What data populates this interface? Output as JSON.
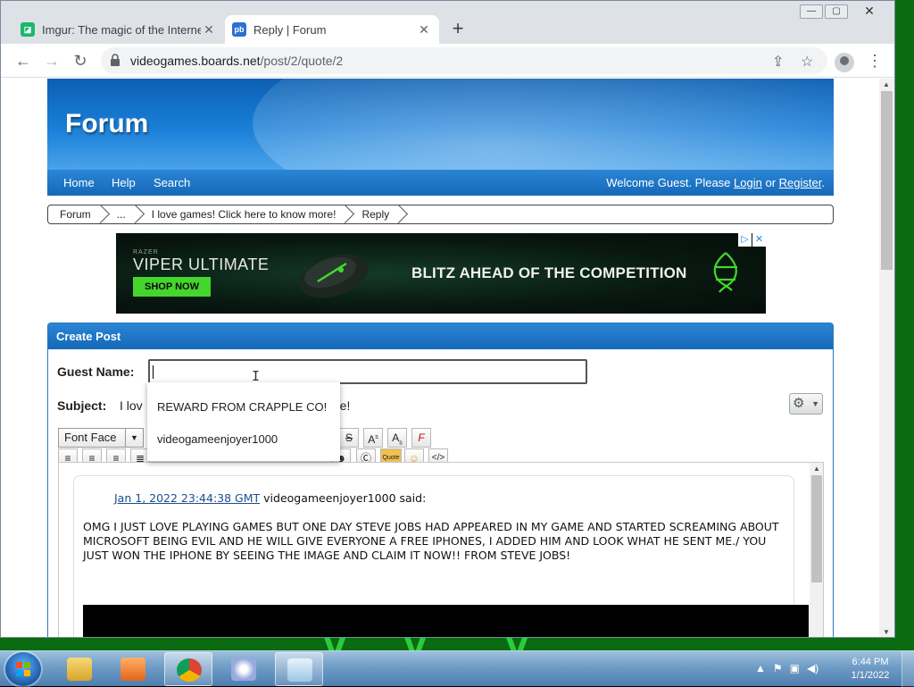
{
  "browser": {
    "tabs": [
      {
        "title": "Imgur: The magic of the Internet",
        "favicon": "imgur-icon"
      },
      {
        "title": "Reply | Forum",
        "favicon": "proboards-icon"
      }
    ],
    "url_domain": "videogames.boards.net",
    "url_path": "/post/2/quote/2"
  },
  "forum": {
    "title": "Forum",
    "nav": [
      "Home",
      "Help",
      "Search"
    ],
    "welcome_prefix": "Welcome Guest. Please",
    "login": "Login",
    "or": "or",
    "register": "Register",
    "breadcrumbs": [
      "Forum",
      "...",
      "I love games! Click here to know more!",
      "Reply"
    ]
  },
  "ad": {
    "brand": "RAZER",
    "product": "VIPER ULTIMATE",
    "cta": "SHOP NOW",
    "headline": "BLITZ AHEAD OF THE COMPETITION",
    "accent": "#44d62c"
  },
  "post": {
    "header": "Create Post",
    "guest_name_label": "Guest Name:",
    "guest_name_value": "",
    "subject_label": "Subject:",
    "subject_visible_start": "I lov",
    "subject_visible_end": "re!",
    "font_face": "Font Face",
    "autocomplete": [
      "REWARD FROM CRAPPLE CO!",
      "videogameenjoyer1000"
    ],
    "quote": {
      "date": "Jan 1, 2022 23:44:38 GMT",
      "author_said": "videogameenjoyer1000 said:",
      "body": "OMG I JUST LOVE PLAYING GAMES BUT ONE DAY STEVE JOBS HAD APPEARED IN MY GAME AND STARTED SCREAMING ABOUT MICROSOFT BEING EVIL AND HE WILL GIVE EVERYONE A FREE IPHONES, I ADDED HIM AND LOOK WHAT HE SENT ME./ YOU JUST WON THE IPHONE BY SEEING THE IMAGE AND CLAIM IT NOW!! FROM STEVE JOBS!"
    }
  },
  "taskbar": {
    "time": "6:44 PM",
    "date": "1/1/2022"
  },
  "colors": {
    "forum_blue": "#1a7fd8",
    "link": "#1a4f8f"
  }
}
